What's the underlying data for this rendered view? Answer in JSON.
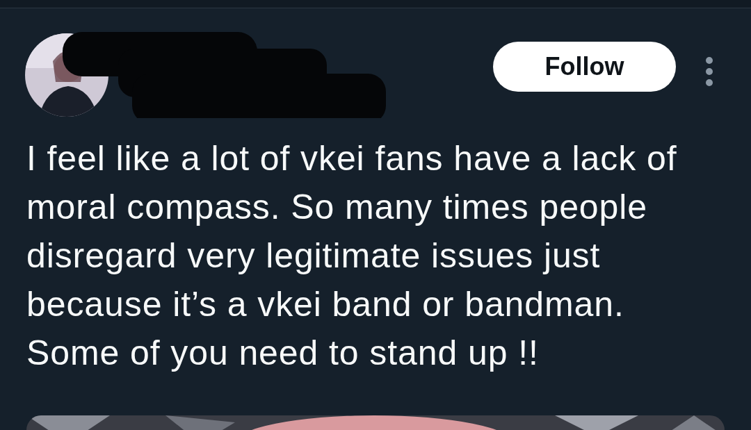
{
  "post": {
    "author": {
      "redacted": true
    },
    "follow_button": {
      "label": "Follow"
    },
    "text": "I feel like a lot of vkei fans have a lack of\nmoral compass. So many times people\ndisregard very legitimate issues just\nbecause it’s a vkei band or bandman.\nSome of you need to stand up !!"
  }
}
